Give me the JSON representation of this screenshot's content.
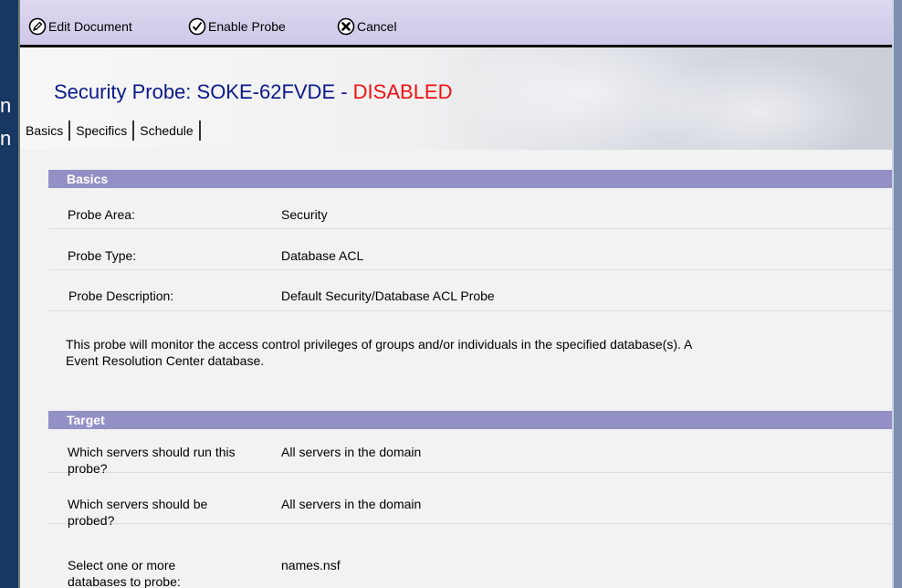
{
  "background": {
    "left_strip_text": [
      "n",
      "n"
    ]
  },
  "toolbar": {
    "edit_label": "Edit Document",
    "enable_label": "Enable Probe",
    "cancel_label": "Cancel",
    "icons": [
      "pencil-icon",
      "checkmark-icon",
      "x-circle-icon"
    ]
  },
  "header": {
    "title": "Security Probe: SOKE-62FVDE - ",
    "status": "DISABLED",
    "status_color": "#ee1111"
  },
  "tabs": [
    {
      "label": "Basics"
    },
    {
      "label": "Specifics"
    },
    {
      "label": "Schedule"
    }
  ],
  "basics": {
    "header": "Basics",
    "rows": [
      {
        "label": "Probe Area:",
        "value": "Security"
      },
      {
        "label": "Probe Type:",
        "value": "Database ACL"
      },
      {
        "label": "Probe Description:",
        "value": "Default Security/Database ACL Probe"
      }
    ],
    "description_line1": "This probe will monitor the access control privileges of groups and/or individuals in the specified database(s).  A",
    "description_line2": "Event Resolution Center database."
  },
  "target": {
    "header": "Target",
    "rows": [
      {
        "label": "Which servers should run this probe?",
        "value": "All servers in the domain"
      },
      {
        "label": "Which servers should be probed?",
        "value": "All servers in the domain"
      },
      {
        "label": "Select one or more databases to probe:",
        "value": "names.nsf"
      }
    ]
  },
  "colors": {
    "section_header_bg": "#9390c6",
    "title_color": "#0a1a8a",
    "toolbar_bg": "#d6d0ec"
  }
}
